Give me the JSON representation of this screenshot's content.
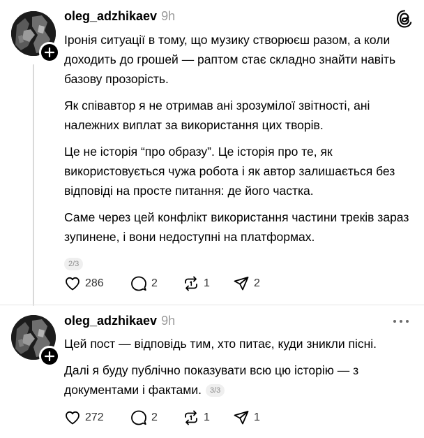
{
  "posts": [
    {
      "username": "oleg_adzhikaev",
      "time": "9h",
      "paragraphs": [
        "Іронія ситуації в тому, що музику створюєш разом, а коли доходить до грошей — раптом стає складно знайти навіть базову прозорість.",
        "Як співавтор я не отримав ані зрозумілої звітності, ані належних виплат за використання цих творів.",
        "Це не історія “про образу”. Це історія про те, як використовується чужа робота і як автор залишається без відповіді на просте питання: де його частка.",
        "Саме через цей конфлікт використання частини треків зараз зупинене, і вони недоступні на платформах."
      ],
      "counter": "2/3",
      "likes": "286",
      "replies": "2",
      "reposts": "1",
      "shares": "2",
      "corner_icon": "threads-logo-icon"
    },
    {
      "username": "oleg_adzhikaev",
      "time": "9h",
      "paragraphs": [
        "Цей пост — відповідь тим, хто питає, куди зникли пісні.",
        "Далі я буду публічно показувати всю цю історію — з документами і фактами."
      ],
      "counter": "3/3",
      "likes": "272",
      "replies": "2",
      "reposts": "1",
      "shares": "1",
      "corner_icon": "more-icon"
    }
  ],
  "colors": {
    "text": "#000000",
    "muted": "#9a9a9a",
    "divider": "#e5e5e5",
    "thread_line": "#d9d9d9"
  }
}
